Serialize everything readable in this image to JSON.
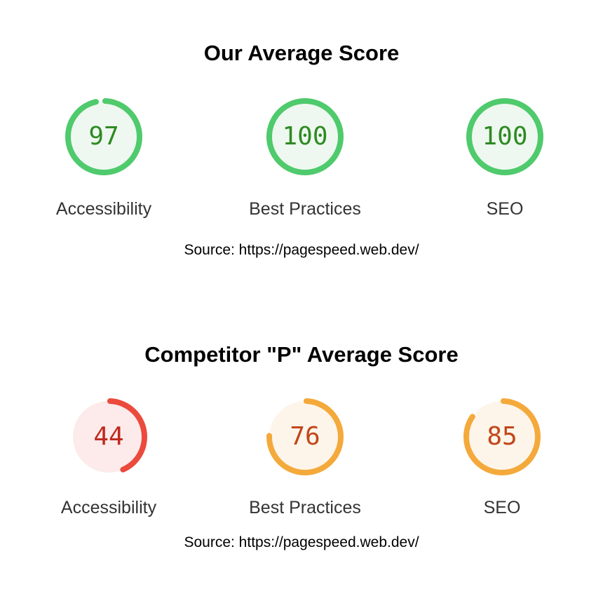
{
  "sections": [
    {
      "title": "Our Average Score",
      "source": "Source: https://pagespeed.web.dev/",
      "gauges": [
        {
          "label": "Accessibility",
          "score": "97"
        },
        {
          "label": "Best Practices",
          "score": "100"
        },
        {
          "label": "SEO",
          "score": "100"
        }
      ]
    },
    {
      "title": "Competitor \"P\" Average Score",
      "source": "Source: https://pagespeed.web.dev/",
      "gauges": [
        {
          "label": "Accessibility",
          "score": "44"
        },
        {
          "label": "Best Practices",
          "score": "76"
        },
        {
          "label": "SEO",
          "score": "85"
        }
      ]
    }
  ],
  "colors": {
    "pass": {
      "stroke": "#4fca6c",
      "fill": "#eef8f0",
      "text": "#2e8a22"
    },
    "average": {
      "stroke": "#f4a93b",
      "fill": "#fdf5ea",
      "text": "#c2461a"
    },
    "fail": {
      "stroke": "#eb4a3c",
      "fill": "#fcebea",
      "text": "#c0291f"
    }
  }
}
